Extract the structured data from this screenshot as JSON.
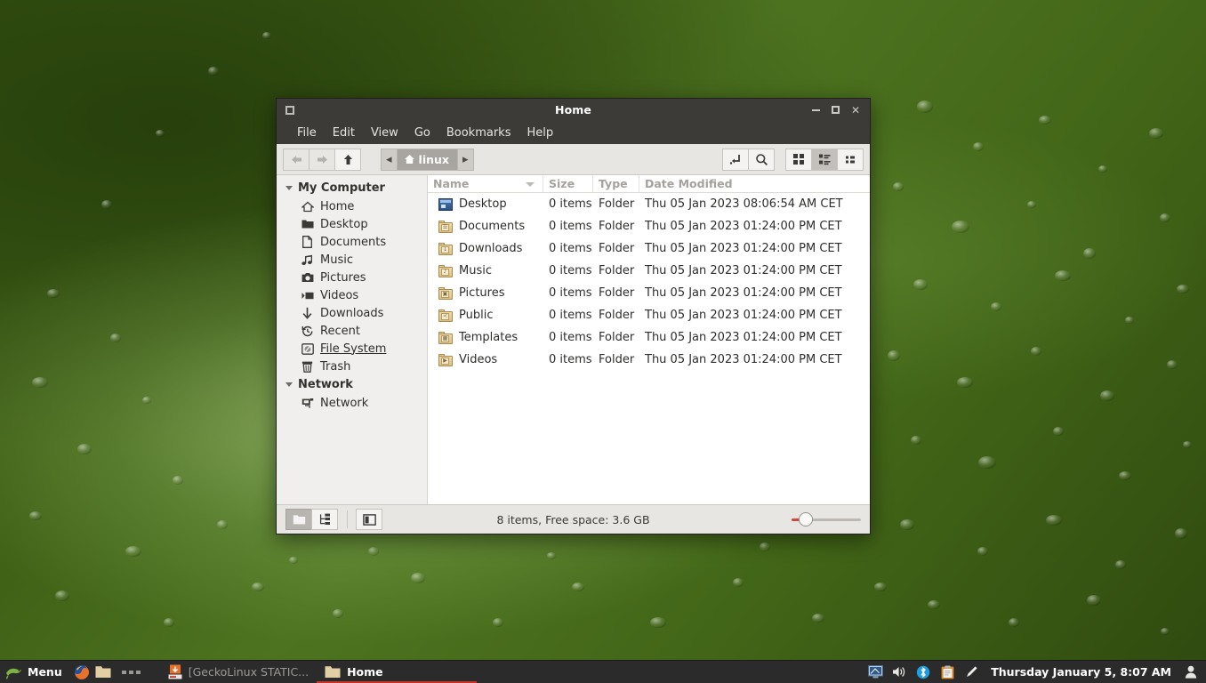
{
  "desktop": {
    "wallpaper_name": "green-water-droplets",
    "base_color": "#3d5e14"
  },
  "window": {
    "title": "Home",
    "app_icon": "window-icon",
    "controls": {
      "minimize": "minimize-button",
      "maximize": "maximize-button",
      "close": "✕"
    },
    "menus": [
      "File",
      "Edit",
      "View",
      "Go",
      "Bookmarks",
      "Help"
    ],
    "toolbar": {
      "back": "back-arrow",
      "forward": "forward-arrow",
      "up": "up-arrow",
      "path_prev": "◂",
      "path_next": "▸",
      "crumb": "linux",
      "open_terminal": "open-location-icon",
      "search": "search-icon",
      "view_icons": "icon-view",
      "view_list": "list-view",
      "view_compact": "compact-view",
      "active_view": "list-view"
    },
    "sidebar": {
      "groups": [
        {
          "label": "My Computer",
          "items": [
            {
              "label": "Home",
              "icon": "home-icon"
            },
            {
              "label": "Desktop",
              "icon": "desktop-folder-icon"
            },
            {
              "label": "Documents",
              "icon": "document-icon"
            },
            {
              "label": "Music",
              "icon": "music-note-icon"
            },
            {
              "label": "Pictures",
              "icon": "camera-icon"
            },
            {
              "label": "Videos",
              "icon": "video-icon"
            },
            {
              "label": "Downloads",
              "icon": "download-arrow-icon"
            },
            {
              "label": "Recent",
              "icon": "recent-clock-icon"
            },
            {
              "label": "File System",
              "icon": "harddisk-icon",
              "hovered": true
            },
            {
              "label": "Trash",
              "icon": "trash-icon"
            }
          ]
        },
        {
          "label": "Network",
          "items": [
            {
              "label": "Network",
              "icon": "network-icon"
            }
          ]
        }
      ]
    },
    "file_list": {
      "columns": [
        "Name",
        "Size",
        "Type",
        "Date Modified"
      ],
      "sort_column": "Name",
      "sort_direction": "descending-indicator",
      "rows": [
        {
          "name": "Desktop",
          "size": "0 items",
          "type": "Folder",
          "date": "Thu 05 Jan 2023 08:06:54 AM CET",
          "icon": "desktop-icon"
        },
        {
          "name": "Documents",
          "size": "0 items",
          "type": "Folder",
          "date": "Thu 05 Jan 2023 01:24:00 PM CET",
          "icon": "folder-documents",
          "emblem": "☰"
        },
        {
          "name": "Downloads",
          "size": "0 items",
          "type": "Folder",
          "date": "Thu 05 Jan 2023 01:24:00 PM CET",
          "icon": "folder-downloads",
          "emblem": "↓"
        },
        {
          "name": "Music",
          "size": "0 items",
          "type": "Folder",
          "date": "Thu 05 Jan 2023 01:24:00 PM CET",
          "icon": "folder-music",
          "emblem": "♪"
        },
        {
          "name": "Pictures",
          "size": "0 items",
          "type": "Folder",
          "date": "Thu 05 Jan 2023 01:24:00 PM CET",
          "icon": "folder-pictures",
          "emblem": "▣"
        },
        {
          "name": "Public",
          "size": "0 items",
          "type": "Folder",
          "date": "Thu 05 Jan 2023 01:24:00 PM CET",
          "icon": "folder-public",
          "emblem": "≺"
        },
        {
          "name": "Templates",
          "size": "0 items",
          "type": "Folder",
          "date": "Thu 05 Jan 2023 01:24:00 PM CET",
          "icon": "folder-templates",
          "emblem": "▦"
        },
        {
          "name": "Videos",
          "size": "0 items",
          "type": "Folder",
          "date": "Thu 05 Jan 2023 01:24:00 PM CET",
          "icon": "folder-videos",
          "emblem": "▶"
        }
      ]
    },
    "statusbar": {
      "places_button": "places-view-icon",
      "tree_button": "tree-view-icon",
      "sidebar_toggle": "toggle-sidebar-icon",
      "text": "8 items, Free space: 3.6 GB",
      "zoom_value": 12
    }
  },
  "taskbar": {
    "menu": {
      "label": "Menu",
      "icon": "gecko-logo-icon"
    },
    "launchers": [
      {
        "name": "firefox-launcher",
        "icon": "firefox-icon"
      },
      {
        "name": "filemanager-launcher",
        "icon": "folder-icon"
      },
      {
        "name": "show-desktop",
        "icon": "dots-icon"
      }
    ],
    "windows": [
      {
        "label": "[GeckoLinux STATIC...",
        "icon": "installer-icon",
        "active": false
      },
      {
        "label": "Home",
        "icon": "folder-icon",
        "active": true
      }
    ],
    "tray": [
      {
        "name": "display-settings-icon",
        "glyph": "▣"
      },
      {
        "name": "volume-icon",
        "glyph": "🔊"
      },
      {
        "name": "bluetooth-icon",
        "glyph": "ᛒ"
      },
      {
        "name": "clipboard-icon",
        "glyph": "📋"
      },
      {
        "name": "pencil-icon",
        "glyph": "✐"
      }
    ],
    "clock": "Thursday January 5, 8:07 AM",
    "user": {
      "name": "user-icon",
      "glyph": "👤"
    },
    "accent_color": "#c4342a"
  }
}
